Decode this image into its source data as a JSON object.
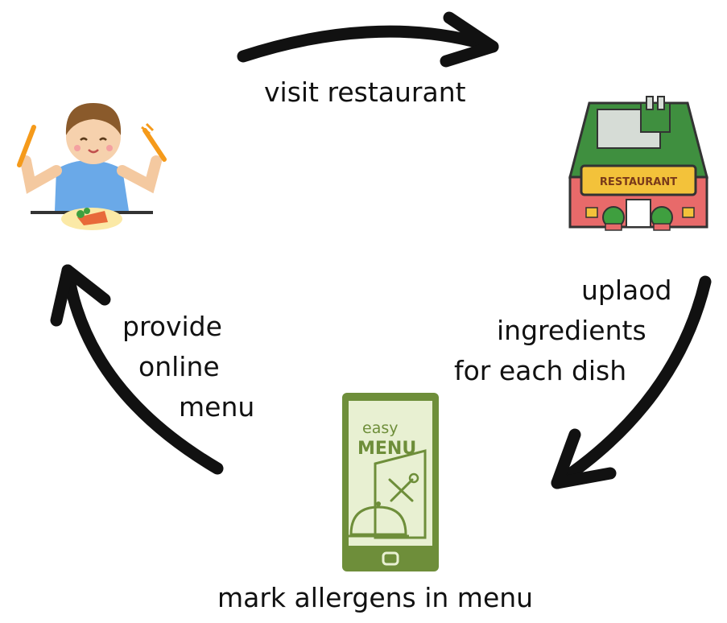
{
  "diagram": {
    "steps": {
      "visit": "visit restaurant",
      "upload_line1": "uplaod",
      "upload_line2": "ingredients",
      "upload_line3": "for each dish",
      "mark": "mark allergens in menu",
      "provide_line1": "provide",
      "provide_line2": "online",
      "provide_line3": "menu"
    },
    "restaurant_sign": "RESTAURANT",
    "phone_app": {
      "line1": "easy",
      "line2": "MENU"
    },
    "colors": {
      "arrow": "#111111",
      "restaurant_roof": "#3f8f3f",
      "restaurant_wall": "#e86a6a",
      "sign": "#f3c23a",
      "phone": "#6e8e3a",
      "phone_screen": "#e8f0d2",
      "kid_shirt": "#6aa9e8"
    }
  }
}
